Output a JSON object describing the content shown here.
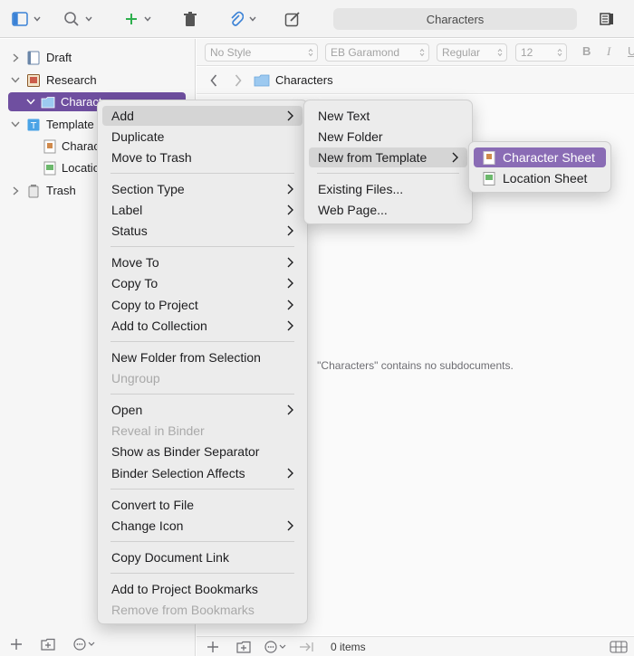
{
  "toolbar": {
    "title": "Characters"
  },
  "binder": {
    "rows": [
      {
        "label": "Draft"
      },
      {
        "label": "Research"
      },
      {
        "label": "Charact"
      },
      {
        "label": "Template"
      },
      {
        "label": "Charac"
      },
      {
        "label": "Locatio"
      },
      {
        "label": "Trash"
      }
    ]
  },
  "format_bar": {
    "style": "No Style",
    "font": "EB Garamond",
    "weight": "Regular",
    "size": "12",
    "bold": "B",
    "italic": "I",
    "underline": "U"
  },
  "navbar": {
    "title": "Characters"
  },
  "editor": {
    "empty_message": "\"Characters\" contains no subdocuments."
  },
  "footer": {
    "items_count": "0 items"
  },
  "context_menu": {
    "items": [
      "Add",
      "Duplicate",
      "Move to Trash",
      "Section Type",
      "Label",
      "Status",
      "Move To",
      "Copy To",
      "Copy to Project",
      "Add to Collection",
      "New Folder from Selection",
      "Ungroup",
      "Open",
      "Reveal in Binder",
      "Show as Binder Separator",
      "Binder Selection Affects",
      "Convert to File",
      "Change Icon",
      "Copy Document Link",
      "Add to Project Bookmarks",
      "Remove from Bookmarks"
    ]
  },
  "add_submenu": {
    "items": [
      "New Text",
      "New Folder",
      "New from Template",
      "Existing Files...",
      "Web Page..."
    ]
  },
  "template_submenu": {
    "items": [
      "Character Sheet",
      "Location Sheet"
    ]
  },
  "colors": {
    "accent": "#6f4fa0",
    "highlight": "#8a6cb5"
  }
}
